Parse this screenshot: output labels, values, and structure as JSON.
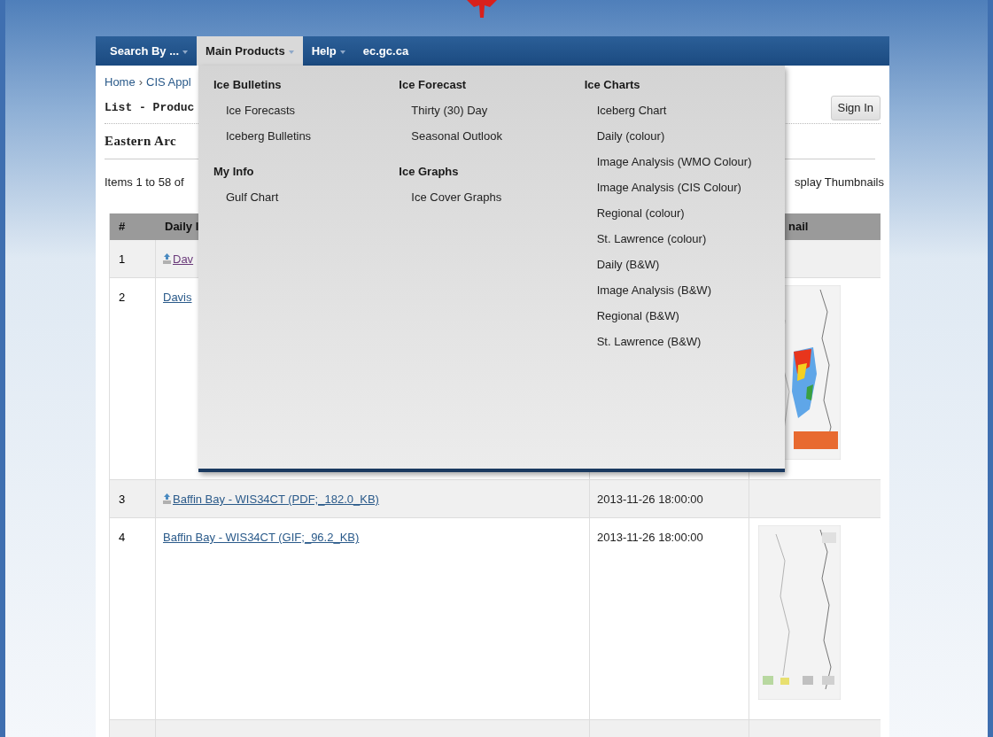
{
  "nav": {
    "items": [
      {
        "label": "Search By ...",
        "caret": true,
        "selected": false
      },
      {
        "label": "Main Products",
        "caret": true,
        "selected": true
      },
      {
        "label": "Help",
        "caret": true,
        "selected": false
      },
      {
        "label": "ec.gc.ca",
        "caret": false,
        "selected": false
      }
    ]
  },
  "dropdown": {
    "columns": [
      {
        "groups": [
          {
            "heading": "Ice Bulletins",
            "items": [
              "Ice Forecasts",
              "Iceberg Bulletins"
            ]
          },
          {
            "heading": "My Info",
            "items": [
              "Gulf Chart"
            ]
          }
        ]
      },
      {
        "groups": [
          {
            "heading": "Ice Forecast",
            "items": [
              "Thirty (30) Day",
              "Seasonal Outlook"
            ]
          },
          {
            "heading": "Ice Graphs",
            "items": [
              "Ice Cover Graphs"
            ]
          }
        ]
      },
      {
        "groups": [
          {
            "heading": "Ice Charts",
            "items": [
              "Iceberg Chart",
              "Daily (colour)",
              "Image Analysis (WMO Colour)",
              "Image Analysis (CIS Colour)",
              "Regional (colour)",
              "St. Lawrence (colour)",
              "Daily (B&W)",
              "Image Analysis (B&W)",
              "Regional (B&W)",
              "St. Lawrence (B&W)"
            ]
          }
        ]
      }
    ]
  },
  "breadcrumb": {
    "items": [
      "Home",
      "CIS Appl"
    ],
    "separator": "›"
  },
  "page_title": "List - Produc",
  "sign_in_button": "Sign In",
  "section_title": "Eastern Arc",
  "items_count": "Items 1 to 58 of",
  "display_thumbnails": "splay Thumbnails",
  "table": {
    "columns": [
      {
        "label": "#"
      },
      {
        "label": "Daily I"
      },
      {},
      {
        "label": "nail"
      }
    ],
    "rows": [
      {
        "number": "1",
        "kind": "pdf",
        "file": "Dav",
        "visited": true
      },
      {
        "number": "2",
        "kind": "gif",
        "file": "Davis",
        "visited": false
      },
      {
        "number": "3",
        "kind": "pdf",
        "file": "Baffin Bay - WIS34CT (PDF;_182.0_KB)",
        "date": "2013-11-26 18:00:00",
        "visited": false
      },
      {
        "number": "4",
        "kind": "gif",
        "file": "Baffin Bay - WIS34CT (GIF;_96.2_KB)",
        "date": "2013-11-26 18:00:00",
        "visited": false
      }
    ]
  }
}
